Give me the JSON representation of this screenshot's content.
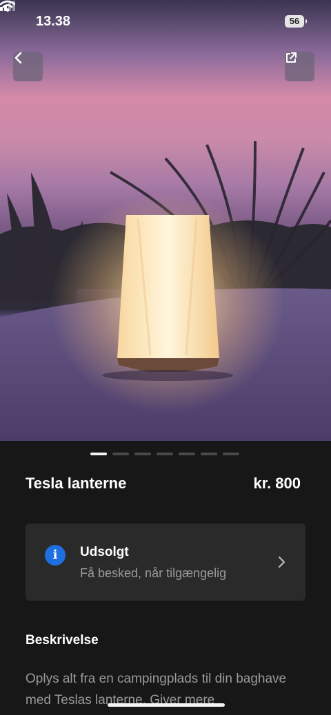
{
  "status_bar": {
    "time": "13.38",
    "battery": "56"
  },
  "header": {
    "back_icon": "chevron-left-icon",
    "share_icon": "external-link-icon"
  },
  "gallery": {
    "image_count": 7,
    "active_index": 0
  },
  "product": {
    "name": "Tesla lanterne",
    "price": "kr. 800"
  },
  "stock_card": {
    "icon": "info-icon",
    "icon_glyph": "i",
    "title": "Udsolgt",
    "subtitle": "Få besked, når tilgængelig"
  },
  "description": {
    "heading": "Beskrivelse",
    "text": "Oplys alt fra en campingplads til din baghave med Teslas lanterne. Giver mere"
  },
  "colors": {
    "background": "#171717",
    "card": "#2a2a2a",
    "info_blue": "#1f6fe0"
  }
}
